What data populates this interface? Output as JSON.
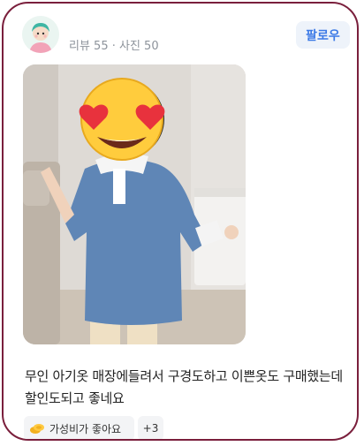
{
  "reviewer": {
    "avatar_icon": "profile-avatar-icon",
    "stats": "리뷰 55 · 사진 50"
  },
  "follow_button": {
    "label": "팔로우"
  },
  "photo": {
    "description_icon": "emoji-heart-eyes-icon"
  },
  "review": {
    "text": "무인 아기옷 매장에들려서 구경도하고 이쁜옷도 구매했는데 할인도되고 좋네요"
  },
  "tags": {
    "main_label": "가성비가 좋아요",
    "main_icon": "coin-icon",
    "more_label": "+3"
  },
  "colors": {
    "accent": "#3c7ae6",
    "card_border": "#7a1f3c",
    "tag_bg": "#f3f4f6"
  }
}
